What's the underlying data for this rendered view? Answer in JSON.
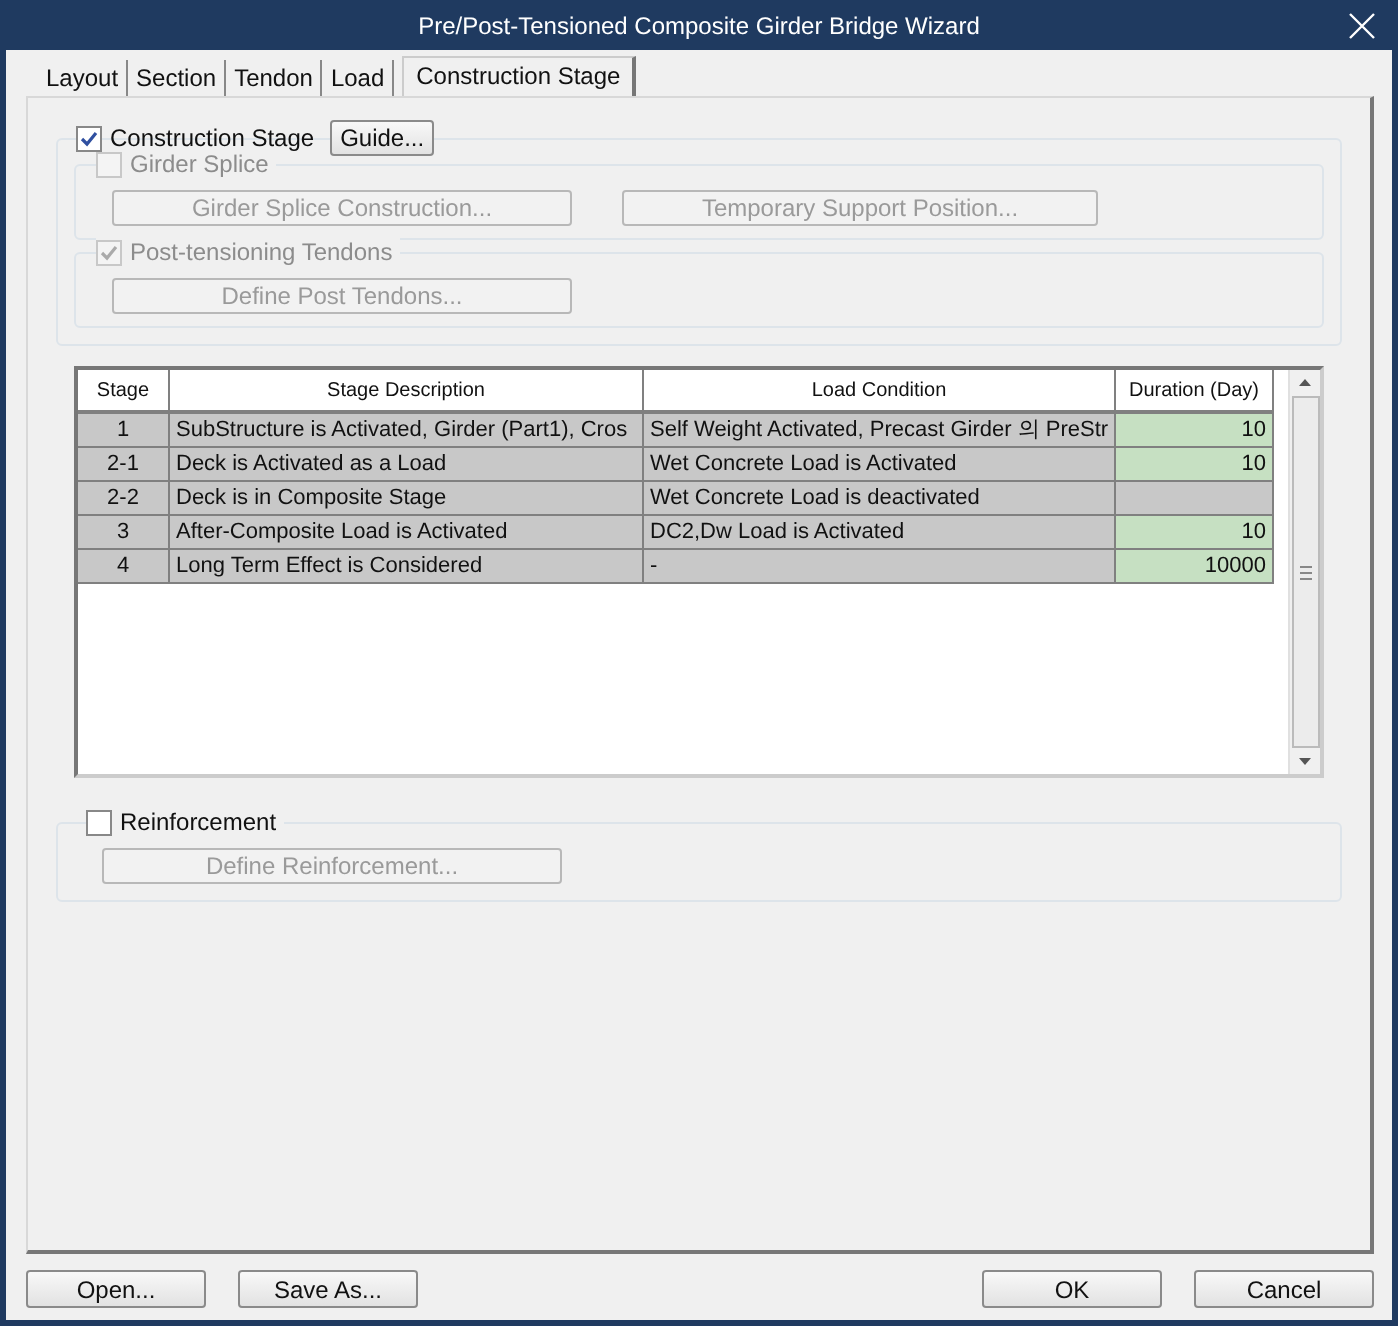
{
  "window": {
    "title": "Pre/Post-Tensioned Composite Girder Bridge Wizard"
  },
  "tabs": [
    {
      "label": "Layout",
      "selected": false
    },
    {
      "label": "Section",
      "selected": false
    },
    {
      "label": "Tendon",
      "selected": false
    },
    {
      "label": "Load",
      "selected": false
    },
    {
      "label": "Construction Stage",
      "selected": true
    }
  ],
  "construction_stage": {
    "label": "Construction Stage",
    "checked": true,
    "guide_button": "Guide..."
  },
  "girder_splice": {
    "label": "Girder Splice",
    "checked": false,
    "disabled": true,
    "buttons": [
      {
        "label": "Girder Splice Construction...",
        "disabled": true
      },
      {
        "label": "Temporary Support Position...",
        "disabled": true
      }
    ]
  },
  "post_tensioning": {
    "label": "Post-tensioning Tendons",
    "checked": true,
    "disabled": true,
    "buttons": [
      {
        "label": "Define Post Tendons...",
        "disabled": true
      }
    ]
  },
  "table": {
    "columns": [
      "Stage",
      "Stage Description",
      "Load Condition",
      "Duration (Day)"
    ],
    "rows": [
      {
        "stage": "1",
        "description": "SubStructure is Activated, Girder (Part1), Cros",
        "load": "Self Weight Activated, Precast Girder 의 PreStr",
        "duration": "10",
        "editable": true
      },
      {
        "stage": "2-1",
        "description": "Deck is Activated as a Load",
        "load": "Wet Concrete Load is Activated",
        "duration": "10",
        "editable": true
      },
      {
        "stage": "2-2",
        "description": "Deck is in Composite Stage",
        "load": "Wet Concrete Load is deactivated",
        "duration": "",
        "editable": false
      },
      {
        "stage": "3",
        "description": "After-Composite Load is Activated",
        "load": "DC2,Dw Load is Activated",
        "duration": "10",
        "editable": true
      },
      {
        "stage": "4",
        "description": "Long Term Effect is Considered",
        "load": "-",
        "duration": "10000",
        "editable": true
      }
    ]
  },
  "reinforcement": {
    "label": "Reinforcement",
    "checked": false,
    "disabled": false,
    "buttons": [
      {
        "label": "Define Reinforcement...",
        "disabled": true
      }
    ]
  },
  "footer_buttons": {
    "left": [
      "Open...",
      "Save As..."
    ],
    "right": [
      "OK",
      "Cancel"
    ]
  }
}
